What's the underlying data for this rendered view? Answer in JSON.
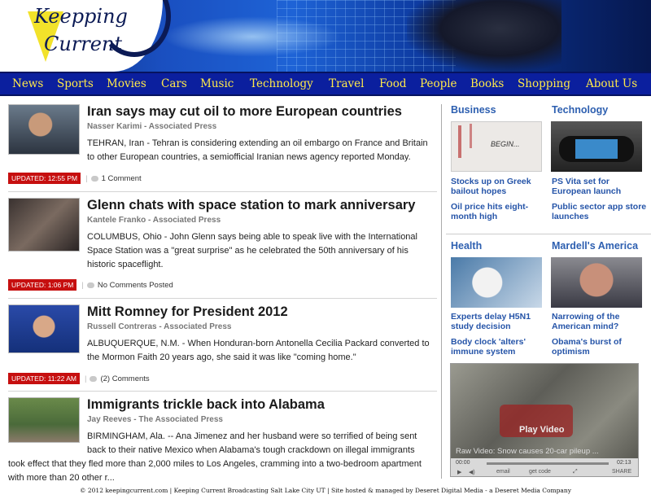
{
  "header": {
    "logo_line1": "Keepping",
    "logo_line2": "Current"
  },
  "nav": [
    "News",
    "Sports",
    "Movies",
    "Cars",
    "Music",
    "Technology",
    "Travel",
    "Food",
    "People",
    "Books",
    "Shopping",
    "About Us"
  ],
  "articles": [
    {
      "title": "Iran says may cut oil to more European countries",
      "author": "Nasser Karimi - Associated Press",
      "body": "TEHRAN, Iran - Tehran is considering extending an oil embargo on France and Britain to other European countries, a semiofficial Iranian news agency reported Monday.",
      "updated": "UPDATED: 12:55 PM",
      "comments": "1 Comment"
    },
    {
      "title": "Glenn chats with space station to mark anniversary",
      "author": "Kantele Franko - Associated Press",
      "body": "COLUMBUS, Ohio - John Glenn says being able to speak live with the International Space Station was a \"great surprise\" as he celebrated the 50th anniversary of his historic spaceflight.",
      "updated": "UPDATED: 1:06 PM",
      "comments": "No Comments Posted"
    },
    {
      "title": "Mitt Romney for President 2012",
      "author": "Russell Contreras - Associated Press",
      "body": "ALBUQUERQUE, N.M. - When Honduran-born Antonella Cecilia Packard converted to the Mormon Faith 20 years ago, she said it was like \"coming home.\"",
      "updated": "UPDATED: 11:22 AM",
      "comments": "(2) Comments"
    },
    {
      "title": "Immigrants trickle back into Alabama",
      "author": "Jay Reeves - The Associated Press",
      "body_a": "BIRMINGHAM, Ala. -- Ana Jimenez and her husband were so terrified of being sent back to their native Mexico when Alabama's tough crackdown on illegal immigrants",
      "body_b": "took effect that they fled more than 2,000 miles to Los Angeles, cramming into a two-bedroom apartment with more than 20 other r..."
    }
  ],
  "sections": {
    "business": {
      "title": "Business",
      "links": [
        "Stocks up on Greek bailout hopes",
        "Oil price hits eight-month high"
      ],
      "image_text": "BEGIN..."
    },
    "technology": {
      "title": "Technology",
      "links": [
        "PS Vita set for European launch",
        "Public sector app store launches"
      ]
    },
    "health": {
      "title": "Health",
      "links": [
        "Experts delay H5N1 study decision",
        "Body clock 'alters' immune system"
      ]
    },
    "mardell": {
      "title": "Mardell's America",
      "links": [
        "Narrowing of the American mind?",
        "Obama's burst of optimism"
      ]
    }
  },
  "video": {
    "play_label": "Play Video",
    "caption": "Raw Video: Snow causes 20-car pileup ...",
    "time_left": "00:00",
    "time_right": "02:13",
    "email": "email",
    "getcode": "get code",
    "share": "SHARE"
  },
  "footer": "© 2012 keepingcurrent.com | Keeping Current Broadcasting Salt Lake City UT | Site hosted & managed by Deseret Digital Media - a Deseret Media Company"
}
